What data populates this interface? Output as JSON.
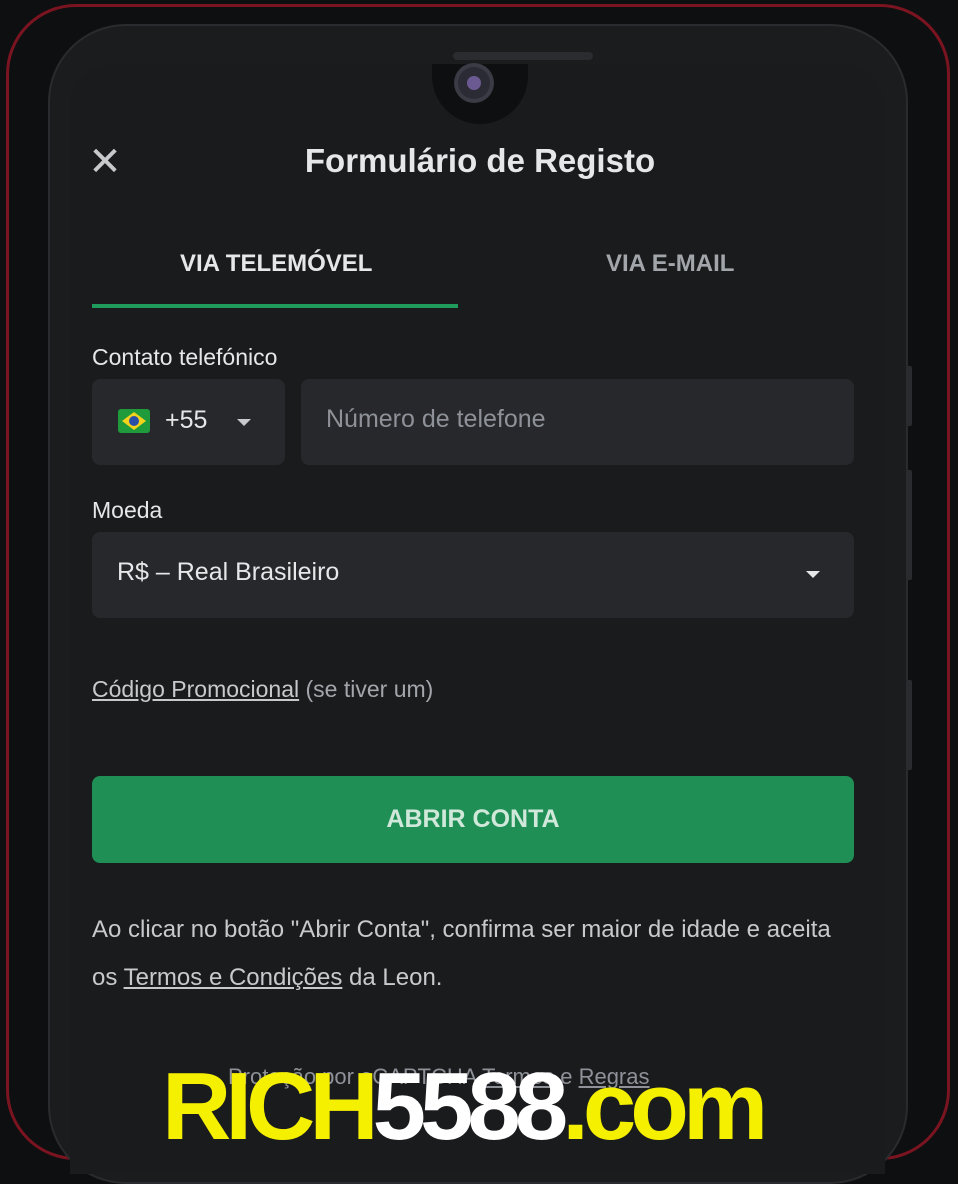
{
  "header": {
    "close_icon": "close-icon",
    "title": "Formulário de Registo"
  },
  "tabs": [
    {
      "label": "VIA TELEMÓVEL",
      "active": true
    },
    {
      "label": "VIA E-MAIL",
      "active": false
    }
  ],
  "phone": {
    "label": "Contato telefónico",
    "country_code": "+55",
    "flag_icon": "brazil-flag-icon",
    "placeholder": "Número de telefone"
  },
  "currency": {
    "label": "Moeda",
    "value": "R$ – Real Brasileiro"
  },
  "promo": {
    "link": "Código Promocional",
    "note": "(se tiver um)"
  },
  "submit": {
    "label": "ABRIR CONTA"
  },
  "legal": {
    "text_before": "Ao clicar no botão \"Abrir Conta\", confirma ser maior de idade e aceita os",
    "link": "Termos e Condições",
    "text_after": "da Leon."
  },
  "footer_partial": {
    "text": "Proteção por eCAPTCHA",
    "link1": "Termos",
    "joiner": "e",
    "link2": "Regras"
  },
  "watermark": {
    "part1": "RICH",
    "part2": "5588",
    "part3": ".com"
  },
  "colors": {
    "accent": "#1f9b5c",
    "button": "#1f8f55",
    "background": "#1a1b1d",
    "frame": "#7a1420",
    "watermark": "#f5f000"
  }
}
